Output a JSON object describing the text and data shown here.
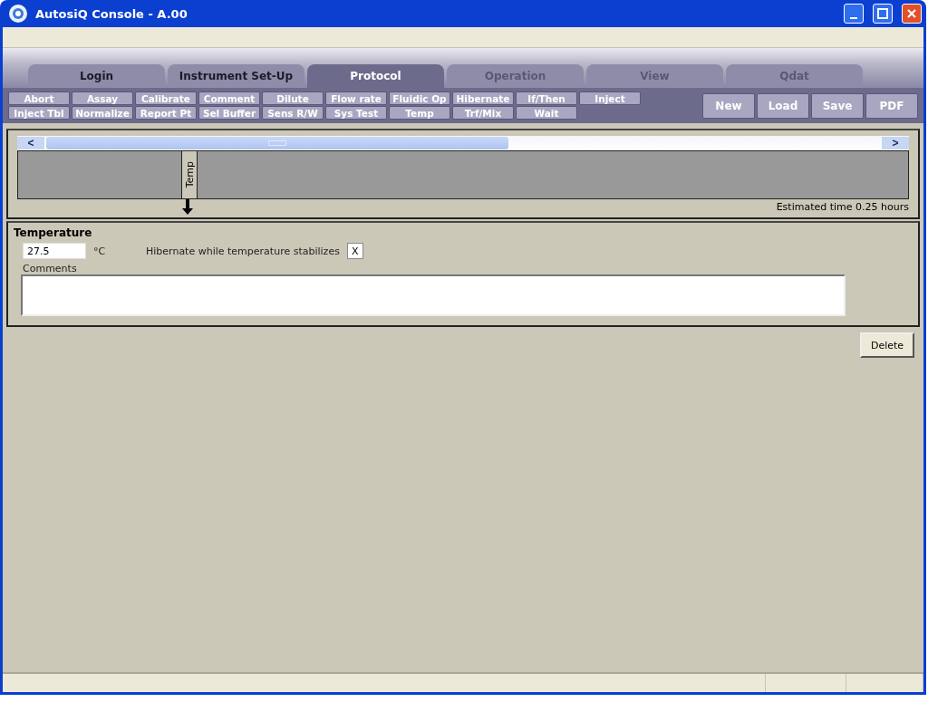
{
  "window": {
    "title": "AutosiQ Console - A.00"
  },
  "tabs": [
    {
      "label": "Login",
      "selected": false,
      "disabled": false
    },
    {
      "label": "Instrument Set-Up",
      "selected": false,
      "disabled": false
    },
    {
      "label": "Protocol",
      "selected": true,
      "disabled": false
    },
    {
      "label": "Operation",
      "selected": false,
      "disabled": true
    },
    {
      "label": "View",
      "selected": false,
      "disabled": true
    },
    {
      "label": "Qdat",
      "selected": false,
      "disabled": true
    }
  ],
  "commands": [
    "Abort",
    "Assay",
    "Calibrate",
    "Comment",
    "Dilute",
    "Flow rate",
    "Fluidic Op",
    "Hibernate",
    "If/Then",
    "Inject",
    "Inject Tbl",
    "Normalize",
    "Report Pt",
    "Sel Buffer",
    "Sens R/W",
    "Sys Test",
    "Temp",
    "Trf/Mix",
    "Wait"
  ],
  "file_buttons": [
    "New",
    "Load",
    "Save",
    "PDF"
  ],
  "timeline": {
    "scroll_left": "<",
    "scroll_right": ">",
    "steps": [
      {
        "label": "Temp",
        "selected": true
      }
    ],
    "estimate": "Estimated time 0.25 hours"
  },
  "step_editor": {
    "title": "Temperature",
    "temperature": "27.5",
    "unit": "°C",
    "hibernate_label": "Hibernate while temperature stabilizes",
    "hibernate": {
      "checked": true,
      "mark": "X"
    },
    "comments_label": "Comments"
  },
  "delete_button": "Delete"
}
